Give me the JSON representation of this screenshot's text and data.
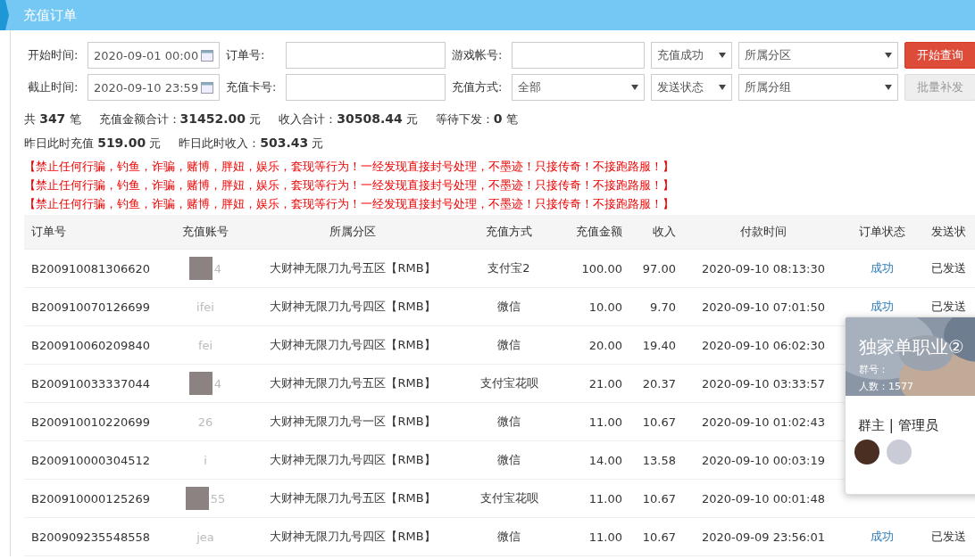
{
  "header": {
    "title": "充值订单"
  },
  "filters": [
    [
      {
        "kind": "label",
        "text": "开始时间:"
      },
      {
        "kind": "date",
        "value": "2020-09-01 00:00"
      },
      {
        "kind": "label",
        "text": "订单号:"
      },
      {
        "kind": "text"
      },
      {
        "kind": "label",
        "text": "游戏帐号:"
      },
      {
        "kind": "text"
      },
      {
        "kind": "select",
        "value": "充值成功"
      },
      {
        "kind": "select",
        "value": "所属分区"
      },
      {
        "kind": "button",
        "label": "开始查询",
        "disabled": false
      }
    ],
    [
      {
        "kind": "label",
        "text": "截止时间:"
      },
      {
        "kind": "date",
        "value": "2020-09-10 23:59"
      },
      {
        "kind": "label",
        "text": "充值卡号:"
      },
      {
        "kind": "text"
      },
      {
        "kind": "label",
        "text": "充值方式:"
      },
      {
        "kind": "select",
        "value": "全部"
      },
      {
        "kind": "select",
        "value": "发送状态"
      },
      {
        "kind": "select",
        "value": "所属分组"
      },
      {
        "kind": "button",
        "label": "批量补发",
        "disabled": true
      }
    ]
  ],
  "summary": [
    [
      "共 **347** 笔",
      "充值金额合计：**31452.00** 元",
      "收入合计：**30508.44** 元",
      "等待下发：**0** 笔"
    ],
    [
      "昨日此时充值 **519.00** 元",
      "昨日此时收入：**503.43** 元"
    ]
  ],
  "warnings": [
    "【禁止任何行骗，钓鱼，诈骗，赌博，胖妞，娱乐，套现等行为！一经发现直接封号处理，不墨迹！只接传奇！不接跑路服！】",
    "【禁止任何行骗，钓鱼，诈骗，赌博，胖妞，娱乐，套现等行为！一经发现直接封号处理，不墨迹！只接传奇！不接跑路服！】",
    "【禁止任何行骗，钓鱼，诈骗，赌博，胖妞，娱乐，套现等行为！一经发现直接封号处理，不墨迹！只接传奇！不接跑路服！】"
  ],
  "table": {
    "columns": [
      "订单号",
      "充值账号",
      "所属分区",
      "充值方式",
      "充值金额",
      "收入",
      "付款时间",
      "订单状态",
      "发送状"
    ],
    "rows": [
      {
        "order_no": "B200910081306620",
        "account": {
          "text": "4",
          "redacted": true
        },
        "zone": "大财神无限刀九号五区【RMB】",
        "method": "支付宝2",
        "amount": "100.00",
        "income": "97.00",
        "paid_at": "2020-09-10 08:13:30",
        "order_status": "成功",
        "send_status": "已发送"
      },
      {
        "order_no": "B200910070126699",
        "account": {
          "text": "ifei",
          "redacted": false
        },
        "zone": "大财神无限刀九号四区【RMB】",
        "method": "微信",
        "amount": "10.00",
        "income": "9.70",
        "paid_at": "2020-09-10 07:01:50",
        "order_status": "成功",
        "send_status": "已发送"
      },
      {
        "order_no": "B200910060209840",
        "account": {
          "text": "fei",
          "redacted": false
        },
        "zone": "大财神无限刀九号四区【RMB】",
        "method": "微信",
        "amount": "20.00",
        "income": "19.40",
        "paid_at": "2020-09-10 06:02:30"
      },
      {
        "order_no": "B200910033337044",
        "account": {
          "text": "4",
          "redacted": true
        },
        "zone": "大财神无限刀九号五区【RMB】",
        "method": "支付宝花呗",
        "amount": "21.00",
        "income": "20.37",
        "paid_at": "2020-09-10 03:33:57"
      },
      {
        "order_no": "B200910010220699",
        "account": {
          "text": "26",
          "redacted": false
        },
        "zone": "大财神无限刀九号一区【RMB】",
        "method": "微信",
        "amount": "11.00",
        "income": "10.67",
        "paid_at": "2020-09-10 01:02:43"
      },
      {
        "order_no": "B200910000304512",
        "account": {
          "text": "i",
          "redacted": false
        },
        "zone": "大财神无限刀九号四区【RMB】",
        "method": "微信",
        "amount": "14.00",
        "income": "13.58",
        "paid_at": "2020-09-10 00:03:19"
      },
      {
        "order_no": "B200910000125269",
        "account": {
          "text": "55",
          "redacted": true
        },
        "zone": "大财神无限刀九号五区【RMB】",
        "method": "支付宝花呗",
        "amount": "11.00",
        "income": "10.67",
        "paid_at": "2020-09-10 00:01:48"
      },
      {
        "order_no": "B200909235548558",
        "account": {
          "text": "jea",
          "redacted": false
        },
        "zone": "大财神无限刀九号四区【RMB】",
        "method": "微信",
        "amount": "11.00",
        "income": "10.67",
        "paid_at": "2020-09-09 23:56:01",
        "order_status": "成功",
        "send_status": "已发送"
      }
    ]
  },
  "group_card": {
    "title": "独家单职业②",
    "number_label": "群号：",
    "members": "人数：1577",
    "roles": "群主 | 管理员"
  }
}
